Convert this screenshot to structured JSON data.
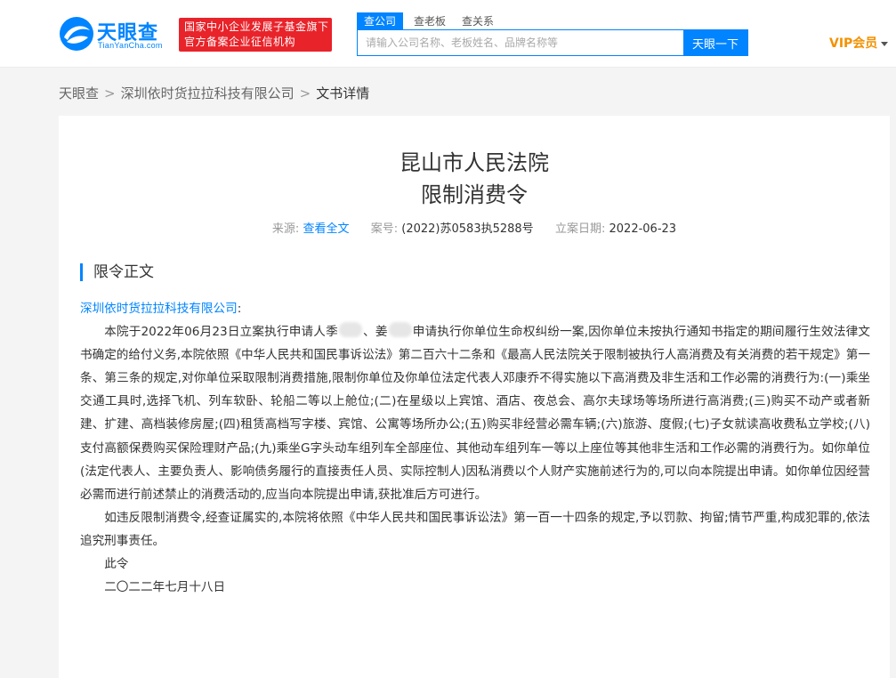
{
  "header": {
    "logo_name": "天眼查",
    "logo_sub": "TianYanCha.com",
    "gov_badge_line1": "国家中小企业发展子基金旗下",
    "gov_badge_line2": "官方备案企业征信机构",
    "search_tabs": [
      "查公司",
      "查老板",
      "查关系"
    ],
    "search_placeholder": "请输入公司名称、老板姓名、品牌名称等",
    "search_button": "天眼一下",
    "vip_label": "VIP会员"
  },
  "breadcrumb": {
    "items": [
      "天眼查",
      "深圳依时货拉拉科技有限公司",
      "文书详情"
    ]
  },
  "document": {
    "court": "昆山市人民法院",
    "title": "限制消费令",
    "meta": {
      "source_label": "来源:",
      "source_link": "查看全文",
      "case_no_label": "案号:",
      "case_no": "(2022)苏0583执5288号",
      "filing_date_label": "立案日期:",
      "filing_date": "2022-06-23"
    },
    "section_title": "限令正文",
    "addressee": "深圳依时货拉拉科技有限公司",
    "addressee_suffix": ":",
    "p1_a": "本院于2022年06月23日立案执行申请人季",
    "p1_b": "、姜",
    "p1_c": "申请执行你单位生命权纠纷一案,因你单位未按执行通知书指定的期间履行生效法律文书确定的给付义务,本院依照《中华人民共和国民事诉讼法》第二百六十二条和《最高人民法院关于限制被执行人高消费及有关消费的若干规定》第一条、第三条的规定,对你单位采取限制消费措施,限制你单位及你单位法定代表人邓康乔不得实施以下高消费及非生活和工作必需的消费行为:(一)乘坐交通工具时,选择飞机、列车软卧、轮船二等以上舱位;(二)在星级以上宾馆、酒店、夜总会、高尔夫球场等场所进行高消费;(三)购买不动产或者新建、扩建、高档装修房屋;(四)租赁高档写字楼、宾馆、公寓等场所办公;(五)购买非经营必需车辆;(六)旅游、度假;(七)子女就读高收费私立学校;(八)支付高额保费购买保险理财产品;(九)乘坐G字头动车组列车全部座位、其他动车组列车一等以上座位等其他非生活和工作必需的消费行为。如你单位(法定代表人、主要负责人、影响债务履行的直接责任人员、实际控制人)因私消费以个人财产实施前述行为的,可以向本院提出申请。如你单位因经营必需而进行前述禁止的消费活动的,应当向本院提出申请,获批准后方可进行。",
    "p2": "如违反限制消费令,经查证属实的,本院将依照《中华人民共和国民事诉讼法》第一百一十四条的规定,予以罚款、拘留;情节严重,构成犯罪的,依法追究刑事责任。",
    "closing": "此令",
    "date": "二〇二二年七月十八日"
  },
  "colors": {
    "accent": "#0084ff",
    "badge": "#e8232a",
    "vip": "#f29100"
  }
}
